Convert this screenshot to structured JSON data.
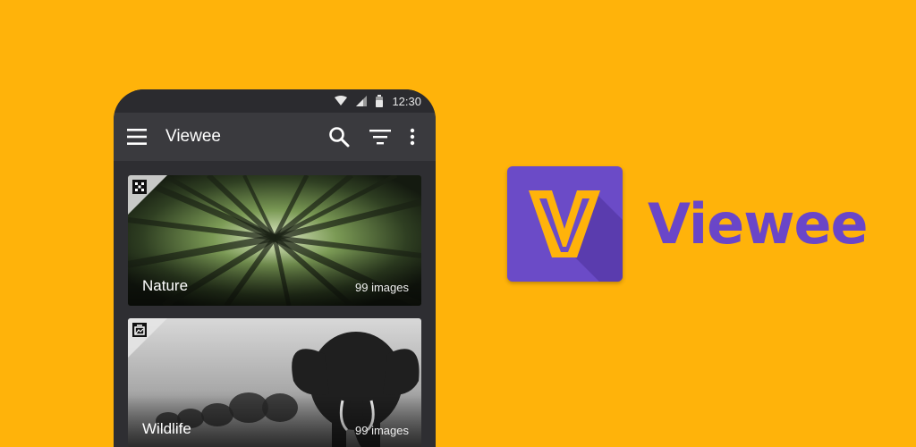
{
  "status": {
    "time": "12:30"
  },
  "app_bar": {
    "title": "Viewee"
  },
  "albums": [
    {
      "title": "Nature",
      "count": "99 images"
    },
    {
      "title": "Wildlife",
      "count": "99 images"
    }
  ],
  "brand": {
    "name": "Viewee"
  },
  "icons": {
    "menu": "menu-icon",
    "search": "search-icon",
    "filter": "filter-icon",
    "more": "more-vert-icon",
    "wifi": "wifi-icon",
    "signal": "signal-icon",
    "battery": "battery-icon",
    "album_type_1": "shuffle-icon",
    "album_type_2": "folder-image-icon",
    "logo": "viewee-logo"
  },
  "colors": {
    "background": "#FFB30A",
    "brand": "#6A46C8",
    "phone": "#2b2b2f",
    "app_bar": "#3a3a3e"
  }
}
